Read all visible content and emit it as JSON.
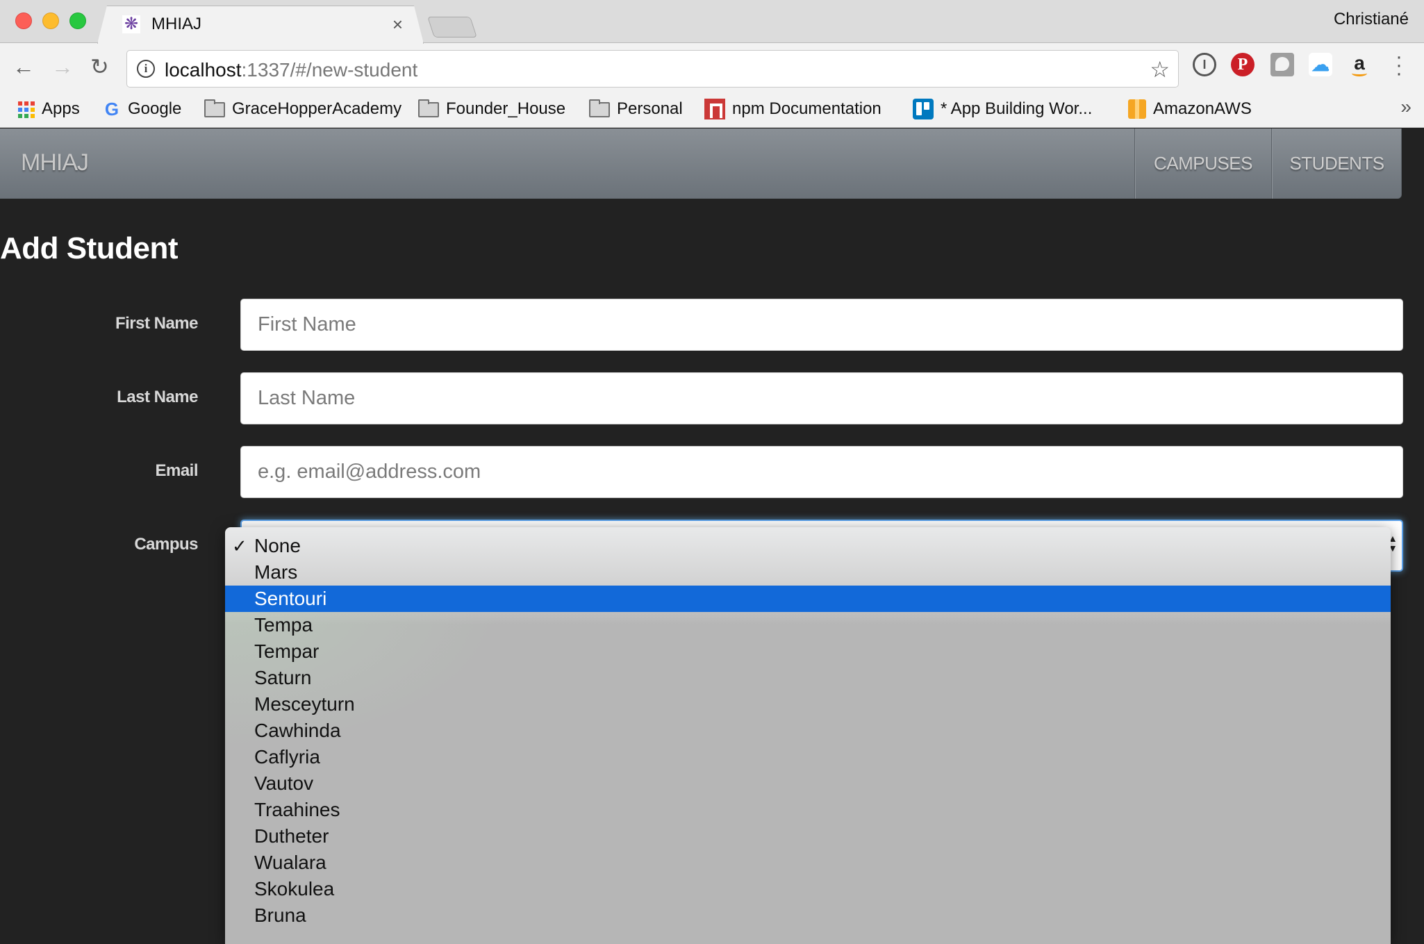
{
  "browser": {
    "tab_title": "MHIAJ",
    "tab_favicon": "snowflake-favicon",
    "profile_name": "Christiané",
    "url_host": "localhost",
    "url_rest": ":1337/#/new-student",
    "bookmarks": [
      {
        "label": "Apps",
        "icon": "apps-grid-icon"
      },
      {
        "label": "Google",
        "icon": "google-icon"
      },
      {
        "label": "GraceHopperAcademy",
        "icon": "folder-icon"
      },
      {
        "label": "Founder_House",
        "icon": "folder-icon"
      },
      {
        "label": "Personal",
        "icon": "folder-icon"
      },
      {
        "label": "npm Documentation",
        "icon": "npm-icon"
      },
      {
        "label": "* App Building Wor...",
        "icon": "trello-icon"
      },
      {
        "label": "AmazonAWS",
        "icon": "aws-icon"
      }
    ],
    "extensions": [
      "1password-icon",
      "pinterest-icon",
      "ghostery-icon",
      "icloud-icon",
      "amazon-icon"
    ],
    "icons": {
      "close": "×",
      "back": "←",
      "forward": "→",
      "reload": "↻",
      "star": "☆",
      "more": "»",
      "menu": "⋮"
    }
  },
  "navbar": {
    "brand": "MHIAJ",
    "links": [
      {
        "label": "CAMPUSES"
      },
      {
        "label": "STUDENTS"
      }
    ],
    "gradient": [
      "#8a9096",
      "#6b7279"
    ]
  },
  "page": {
    "title": "Add Student",
    "background": "#222222"
  },
  "form": {
    "first_name": {
      "label": "First Name",
      "placeholder": "First Name",
      "value": ""
    },
    "last_name": {
      "label": "Last Name",
      "placeholder": "Last Name",
      "value": ""
    },
    "email": {
      "label": "Email",
      "placeholder": "e.g. email@address.com",
      "value": ""
    },
    "campus": {
      "label": "Campus",
      "selected": "None",
      "highlighted": "Sentouri",
      "options": [
        "None",
        "Mars",
        "Sentouri",
        "Tempa",
        "Tempar",
        "Saturn",
        "Mesceyturn",
        "Cawhinda",
        "Caflyria",
        "Vautov",
        "Traahines",
        "Dutheter",
        "Wualara",
        "Skokulea",
        "Bruna"
      ],
      "checkmark": "✓",
      "highlight_color": "#1269d9"
    }
  }
}
